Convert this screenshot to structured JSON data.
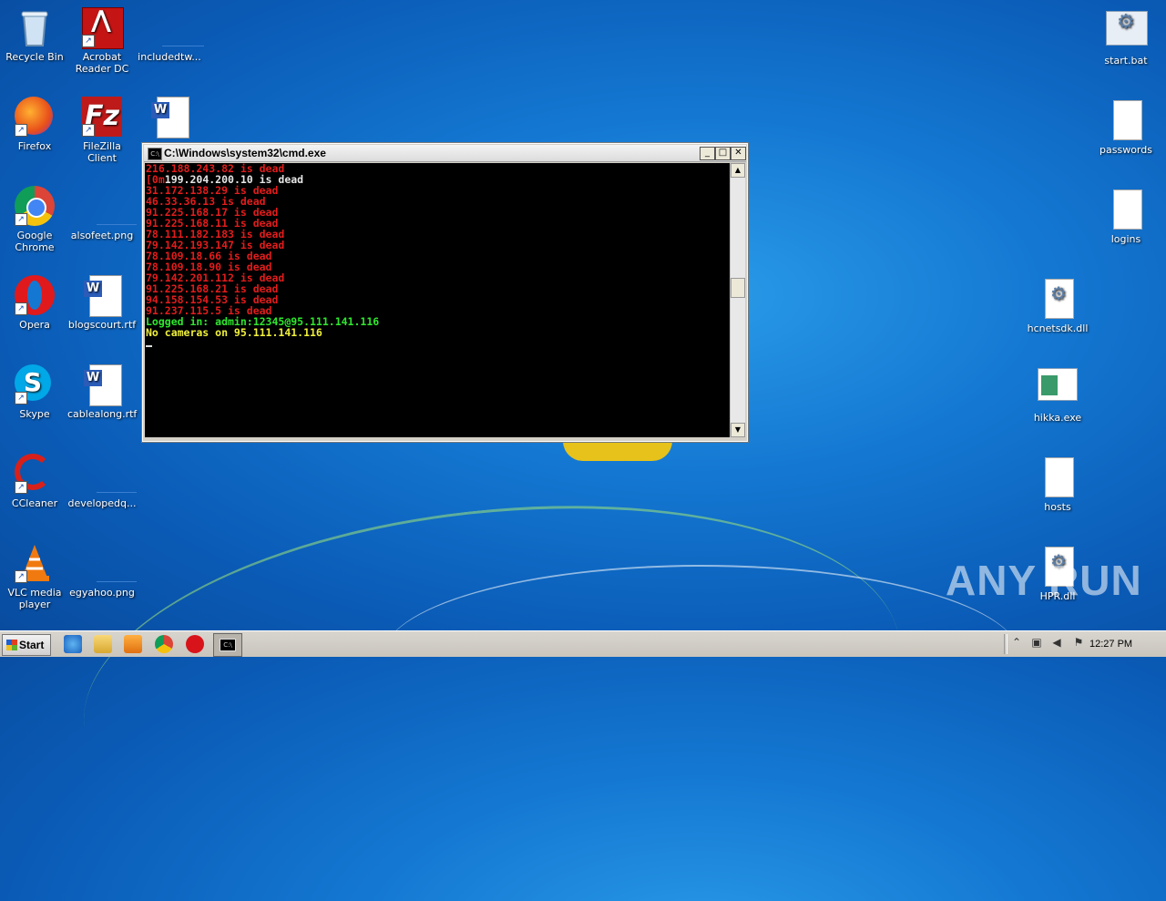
{
  "desktop_icons_left": [
    {
      "name": "recycle-bin",
      "label": "Recycle Bin",
      "icon": "recycle-bin-icon"
    },
    {
      "name": "acrobat",
      "label": "Acrobat Reader DC",
      "icon": "acrobat-icon"
    },
    {
      "name": "includedtw",
      "label": "includedtw...",
      "icon": "file-icon"
    },
    {
      "name": "firefox",
      "label": "Firefox",
      "icon": "firefox-icon"
    },
    {
      "name": "filezilla",
      "label": "FileZilla Client",
      "icon": "filezilla-icon"
    },
    {
      "name": "word-doc",
      "label": "",
      "icon": "word-icon"
    },
    {
      "name": "chrome",
      "label": "Google Chrome",
      "icon": "chrome-icon"
    },
    {
      "name": "alsofeet",
      "label": "alsofeet.png",
      "icon": "image-icon"
    },
    {
      "name": "opera",
      "label": "Opera",
      "icon": "opera-icon"
    },
    {
      "name": "blogscourt",
      "label": "blogscourt.rtf",
      "icon": "word-icon"
    },
    {
      "name": "skype",
      "label": "Skype",
      "icon": "skype-icon"
    },
    {
      "name": "cablealong",
      "label": "cablealong.rtf",
      "icon": "word-icon"
    },
    {
      "name": "ccleaner",
      "label": "CCleaner",
      "icon": "ccleaner-icon"
    },
    {
      "name": "developedq",
      "label": "developedq...",
      "icon": "image-icon"
    },
    {
      "name": "vlc",
      "label": "VLC media player",
      "icon": "vlc-icon"
    },
    {
      "name": "egyahoo",
      "label": "egyahoo.png",
      "icon": "image-icon"
    }
  ],
  "desktop_icons_right": [
    {
      "name": "start-bat",
      "label": "start.bat",
      "icon": "gear-file-icon"
    },
    {
      "name": "passwords",
      "label": "passwords",
      "icon": "blank-file-icon"
    },
    {
      "name": "logins",
      "label": "logins",
      "icon": "blank-file-icon"
    },
    {
      "name": "hcnetsdk",
      "label": "hcnetsdk.dll",
      "icon": "gear-file-icon"
    },
    {
      "name": "hikka",
      "label": "hikka.exe",
      "icon": "exe-icon"
    },
    {
      "name": "hosts",
      "label": "hosts",
      "icon": "blank-file-icon"
    },
    {
      "name": "hpr-dll",
      "label": "HPR.dll",
      "icon": "gear-file-icon"
    }
  ],
  "cmd": {
    "title": "C:\\Windows\\system32\\cmd.exe",
    "lines": [
      {
        "text": "216.188.243.82 is dead",
        "color": "red"
      },
      {
        "text": "[0m",
        "color": "red",
        "rest": "199.204.200.10 is dead"
      },
      {
        "text": "31.172.138.29 is dead",
        "color": "red"
      },
      {
        "text": "46.33.36.13 is dead",
        "color": "red"
      },
      {
        "text": "91.225.168.17 is dead",
        "color": "red"
      },
      {
        "text": "91.225.168.11 is dead",
        "color": "red"
      },
      {
        "text": "78.111.182.183 is dead",
        "color": "red"
      },
      {
        "text": "79.142.193.147 is dead",
        "color": "red"
      },
      {
        "text": "78.109.18.66 is dead",
        "color": "red"
      },
      {
        "text": "78.109.18.90 is dead",
        "color": "red"
      },
      {
        "text": "79.142.201.112 is dead",
        "color": "red"
      },
      {
        "text": "91.225.168.21 is dead",
        "color": "red"
      },
      {
        "text": "94.158.154.53 is dead",
        "color": "red"
      },
      {
        "text": "91.237.115.5 is dead",
        "color": "red"
      },
      {
        "text": "Logged in: admin:12345@95.111.141.116",
        "color": "green"
      },
      {
        "text": "No cameras on 95.111.141.116",
        "color": "yellow"
      }
    ],
    "buttons": {
      "minimize": "_",
      "maximize": "□",
      "close": "✕"
    }
  },
  "taskbar": {
    "start_label": "Start",
    "clock": "12:27 PM",
    "pinned": [
      "ie-icon",
      "explorer-icon",
      "media-player-icon",
      "chrome-icon",
      "opera-icon",
      "cmd-icon"
    ],
    "tray": [
      "arrow-up-icon",
      "network-icon",
      "speaker-icon",
      "flag-icon"
    ]
  },
  "watermark": "ANY RUN"
}
